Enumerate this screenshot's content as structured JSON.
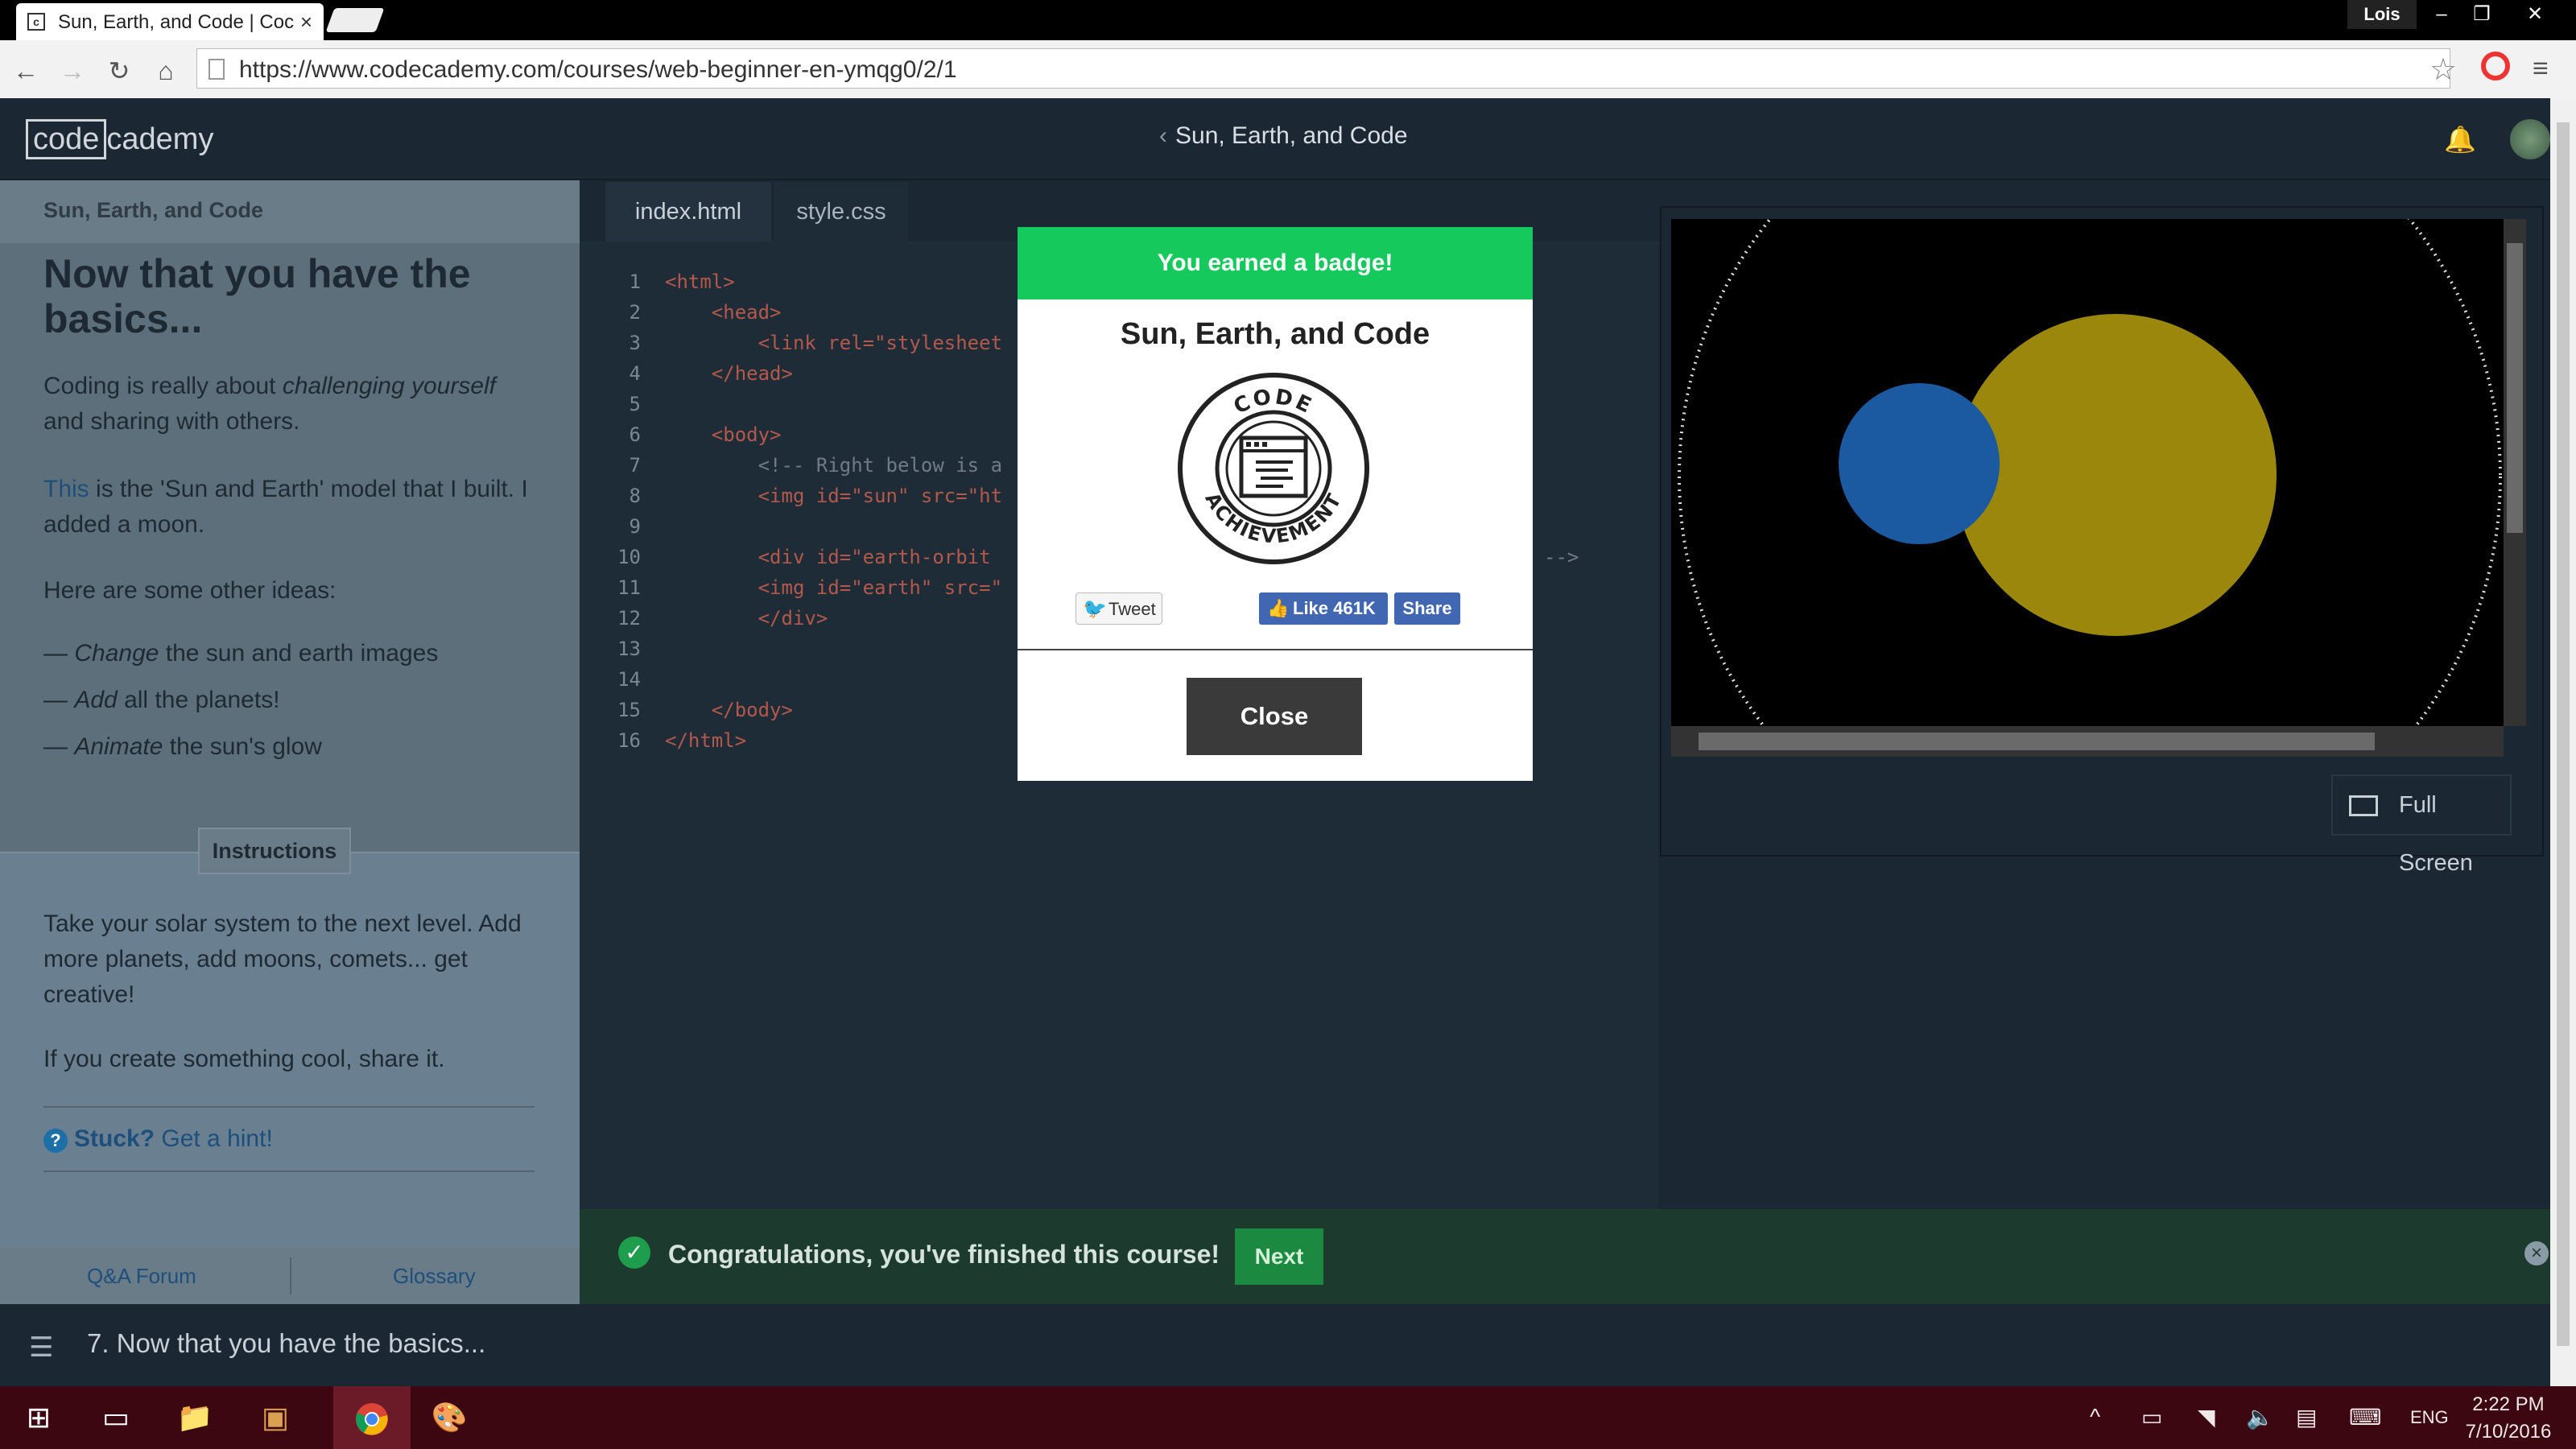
{
  "browser": {
    "tab_title": "Sun, Earth, and Code | Coc",
    "tab_favicon": "c",
    "url": "https://www.codecademy.com/courses/web-beginner-en-ymqg0/2/1",
    "user_chip": "Lois"
  },
  "header": {
    "logo_box": "code",
    "logo_rest": "cademy",
    "course_title": "Sun, Earth, and Code"
  },
  "lesson": {
    "crumb": "Sun, Earth, and Code",
    "title": "Now that you have the basics...",
    "p1_pre": "Coding is really about ",
    "p1_em": "challenging yourself",
    "p1_post": " and sharing with others.",
    "p2_link": "This",
    "p2_rest": " is the 'Sun and Earth' model that I built. I added a moon.",
    "p3": "Here are some other ideas:",
    "ideas": [
      {
        "dash": "— ",
        "em": "Change",
        "rest": " the sun and earth images"
      },
      {
        "dash": "— ",
        "em": "Add",
        "rest": " all the planets!"
      },
      {
        "dash": "— ",
        "em": "Animate",
        "rest": " the sun's glow"
      }
    ],
    "instructions_tab": "Instructions",
    "instr_p1": "Take your solar system to the next level. Add more planets, add moons, comets... get creative!",
    "instr_p2": "If you create something cool, share it.",
    "stuck_bold": "Stuck?",
    "stuck_link": " Get a hint!",
    "footer_left": "Q&A Forum",
    "footer_right": "Glossary"
  },
  "editor": {
    "tabs": [
      "index.html",
      "style.css"
    ],
    "line_numbers": [
      "1",
      "2",
      "3",
      "4",
      "5",
      "6",
      "7",
      "8",
      "9",
      "10",
      "11",
      "12",
      "13",
      "14",
      "15",
      "16"
    ],
    "lines": [
      "<html>",
      "    <head>",
      "        <link rel=\"stylesheet",
      "    </head>",
      "",
      "    <body>",
      "        <!-- Right below is a",
      "        <img id=\"sun\" src=\"ht",
      "",
      "        <div id=\"earth-orbit",
      "        <img id=\"earth\" src=\"",
      "        </div>",
      "",
      "",
      "    </body>",
      "</html>"
    ],
    "line10_tail": "-->"
  },
  "preview": {
    "fullscreen_label": "Full Screen",
    "sun_color": "#9b870c",
    "earth_color": "#1b5aa0"
  },
  "congrats": {
    "message": "Congratulations, you've finished this course!",
    "next_label": "Next",
    "dismiss": "×"
  },
  "bottom_nav": {
    "label": "7. Now that you have the basics..."
  },
  "modal": {
    "header": "You earned a badge!",
    "title": "Sun, Earth, and Code",
    "badge_top": "CODE",
    "badge_bottom": "ACHIEVEMENT",
    "tweet": "Tweet",
    "like": "Like 461K",
    "share": "Share",
    "close": "Close",
    "accent": "#16c95c"
  },
  "taskbar": {
    "lang": "ENG",
    "time": "2:22 PM",
    "date": "7/10/2016"
  }
}
